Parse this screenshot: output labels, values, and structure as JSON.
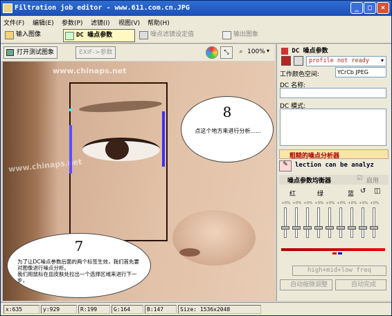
{
  "window": {
    "title": "Filtration job editor - www.611.com.cn.JPG"
  },
  "menu": [
    "文件(F)",
    "编辑(E)",
    "参数(P)",
    "滤镜(I)",
    "视图(V)",
    "帮助(H)"
  ],
  "tabs": [
    "输入图像",
    "DC 噪点参数",
    "噪点滤镜设定值",
    "输出图象"
  ],
  "toolbar": {
    "open_test": "打开测试图象",
    "exif": "EXIF->参数",
    "zoom": "100%"
  },
  "image": {
    "watermark1": "www.chinaps.net",
    "watermark2": "www.chinaps.net"
  },
  "annotations": {
    "num8": "8",
    "text8": "点这个地方来进行分析......",
    "num7": "7",
    "text7": "为了让DC噪点参数后面的两个标签生效，我们首先要对图像进行噪点分析。\n我们用鼠标在皿皮肤处拉出一个选择区域来进行下一步，"
  },
  "panel": {
    "header": "DC 噪点参数",
    "profile_status": "profile not ready",
    "color_space_label": "工作颜色空间:",
    "color_space_value": "YCrCb JPEG",
    "dc_name_label": "DC 名称:",
    "dc_mode_label": "DC 模式:",
    "analyzer_header": "粗糙的噪点分析器",
    "analyzer_text": "lection can be analyz",
    "balancer_header": "噪点参数均衡器",
    "enable_label": "启用",
    "ch_red": "红",
    "ch_green": "绿",
    "ch_blue": "蓝",
    "freq_button": "high+mid+low freq",
    "auto_adjust": "自动缩微调整",
    "auto_done": "自动完成",
    "slider_values": [
      "+0%",
      "+0%",
      "+0%",
      "+0%",
      "+0%",
      "+0%",
      "+0%",
      "+0%",
      "+0%"
    ]
  },
  "status": {
    "x": "x:635",
    "y": "y:929",
    "r": "R:199",
    "g": "G:164",
    "b": "B:147",
    "size": "Size: 1536x2048"
  }
}
